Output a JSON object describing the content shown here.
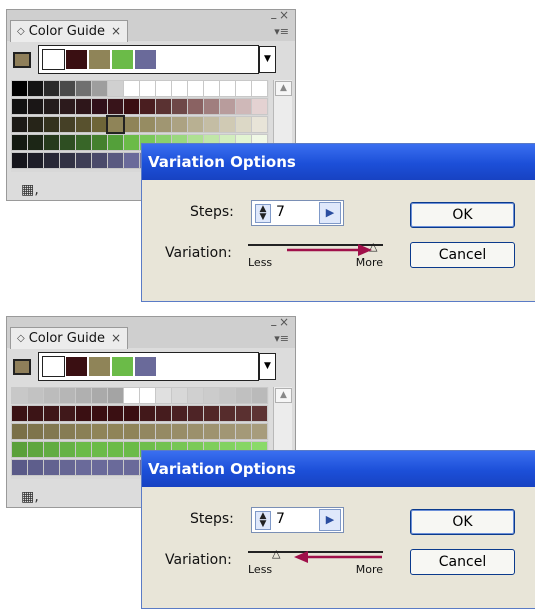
{
  "scenarios": [
    {
      "panel": {
        "tab_label": "Color Guide",
        "base_color": "#8f7f5a",
        "harmony": [
          "#ffffff",
          "#3a0f12",
          "#8f8458",
          "#6bbb48",
          "#6a6a9a"
        ],
        "grid": [
          [
            "#000000",
            "#141414",
            "#2a2a2a",
            "#4a4a4a",
            "#707070",
            "#9e9e9e",
            "#d0d0d0",
            "#ffffff",
            "#ffffff",
            "#ffffff",
            "#ffffff",
            "#ffffff",
            "#ffffff",
            "#ffffff",
            "#ffffff",
            "#ffffff"
          ],
          [
            "#121212",
            "#1a1616",
            "#231c1c",
            "#2c1a1c",
            "#2e161a",
            "#30101a",
            "#38141a",
            "#3a0f12",
            "#4a1e20",
            "#5a3232",
            "#6e4848",
            "#8a6262",
            "#a07e7e",
            "#b89c9c",
            "#cfb8b8",
            "#e4d2d2"
          ],
          [
            "#1c1a16",
            "#262418",
            "#34321e",
            "#454026",
            "#58512e",
            "#6e6538",
            "#8f8458",
            "#8f8458",
            "#968c62",
            "#a09672",
            "#aca282",
            "#b8b092",
            "#c4bda4",
            "#d0cab4",
            "#dcd8c6",
            "#e8e4d8"
          ],
          [
            "#141a12",
            "#1c2616",
            "#263a1c",
            "#2e4e22",
            "#386628",
            "#44802e",
            "#54a03a",
            "#6bbb48",
            "#7ac85a",
            "#8ad06c",
            "#9ad87e",
            "#aee092",
            "#c0e6a8",
            "#d2eebe",
            "#e2f4d2",
            "#f0f8e6"
          ],
          [
            "#16161c",
            "#1e1e28",
            "#282836",
            "#323244",
            "#3e3e56",
            "#4a4a6a",
            "#5a5a80",
            "#6a6a9a",
            "#7a7aa8",
            "#8a8ab4",
            "#9a9ac0",
            "#aaaacc",
            "#babad8",
            "#cacae2",
            "#dadaec",
            "#eaeaf4"
          ]
        ],
        "selected_cell": "#8f8458"
      },
      "dialog": {
        "title": "Variation Options",
        "steps_label": "Steps:",
        "steps_value": "7",
        "variation_label": "Variation:",
        "less_label": "Less",
        "more_label": "More",
        "variation_level": 0.94,
        "ok_label": "OK",
        "cancel_label": "Cancel"
      },
      "arrow_direction": "toward-more"
    },
    {
      "panel": {
        "tab_label": "Color Guide",
        "base_color": "#8f7f5a",
        "harmony": [
          "#ffffff",
          "#3a0f12",
          "#8f8458",
          "#6bbb48",
          "#6a6a9a"
        ],
        "grid": [
          [
            "#c8c8c8",
            "#c2c2c2",
            "#bcbcbc",
            "#b6b6b6",
            "#b0b0b0",
            "#aaaaaa",
            "#a4a4a4",
            "#ffffff",
            "#ffffff",
            "#e0e0e0",
            "#d8d8d8",
            "#d0d0d0",
            "#cccccc",
            "#c6c6c6",
            "#c0c0c0",
            "#bababa"
          ],
          [
            "#3a1214",
            "#3c1416",
            "#3e1618",
            "#40181a",
            "#3a0f12",
            "#3a0f12",
            "#3a0f12",
            "#3a0f12",
            "#42181a",
            "#461c1e",
            "#4a2022",
            "#4e2426",
            "#522828",
            "#562c2c",
            "#5a3030",
            "#5e3434"
          ],
          [
            "#7a7048",
            "#7e744c",
            "#827850",
            "#867c54",
            "#8a8056",
            "#8f8458",
            "#8f8458",
            "#8f8458",
            "#928760",
            "#958a64",
            "#988d68",
            "#9b906c",
            "#9e9370",
            "#a19674",
            "#a49978",
            "#a79c7c"
          ],
          [
            "#5aa03a",
            "#5ea63e",
            "#62ac42",
            "#66b246",
            "#6bbb48",
            "#6bbb48",
            "#6bbb48",
            "#6bbb48",
            "#6ebe4c",
            "#72c250",
            "#76c654",
            "#7aca58",
            "#7ece5c",
            "#82d260",
            "#86d664",
            "#8ada68"
          ],
          [
            "#5a5a88",
            "#5e5e8c",
            "#626290",
            "#666694",
            "#6a6a9a",
            "#6a6a9a",
            "#6a6a9a",
            "#6a6a9a",
            "#6e6e9e",
            "#7272a2",
            "#7676a6",
            "#7a7aaa",
            "#7e7eae",
            "#8282b2",
            "#8686b6",
            "#8a8aba"
          ]
        ],
        "selected_cell": ""
      },
      "dialog": {
        "title": "Variation Options",
        "steps_label": "Steps:",
        "steps_value": "7",
        "variation_label": "Variation:",
        "less_label": "Less",
        "more_label": "More",
        "variation_level": 0.22,
        "ok_label": "OK",
        "cancel_label": "Cancel"
      },
      "arrow_direction": "toward-less"
    }
  ],
  "annotation_color": "#a0104a",
  "icons": {
    "panel_tab": "diamond-icon",
    "tab_close": "close-icon",
    "panel_close": "close-icon",
    "panel_collapse": "minimize-icon",
    "panel_menu": "menu-icon",
    "harmony_dropdown": "chevron-down-icon",
    "grid_toggle": "grid-icon",
    "stepper_arrows": "up-down-icon",
    "stepper_next": "chevron-right-icon",
    "scroll_up": "scroll-up-icon"
  }
}
